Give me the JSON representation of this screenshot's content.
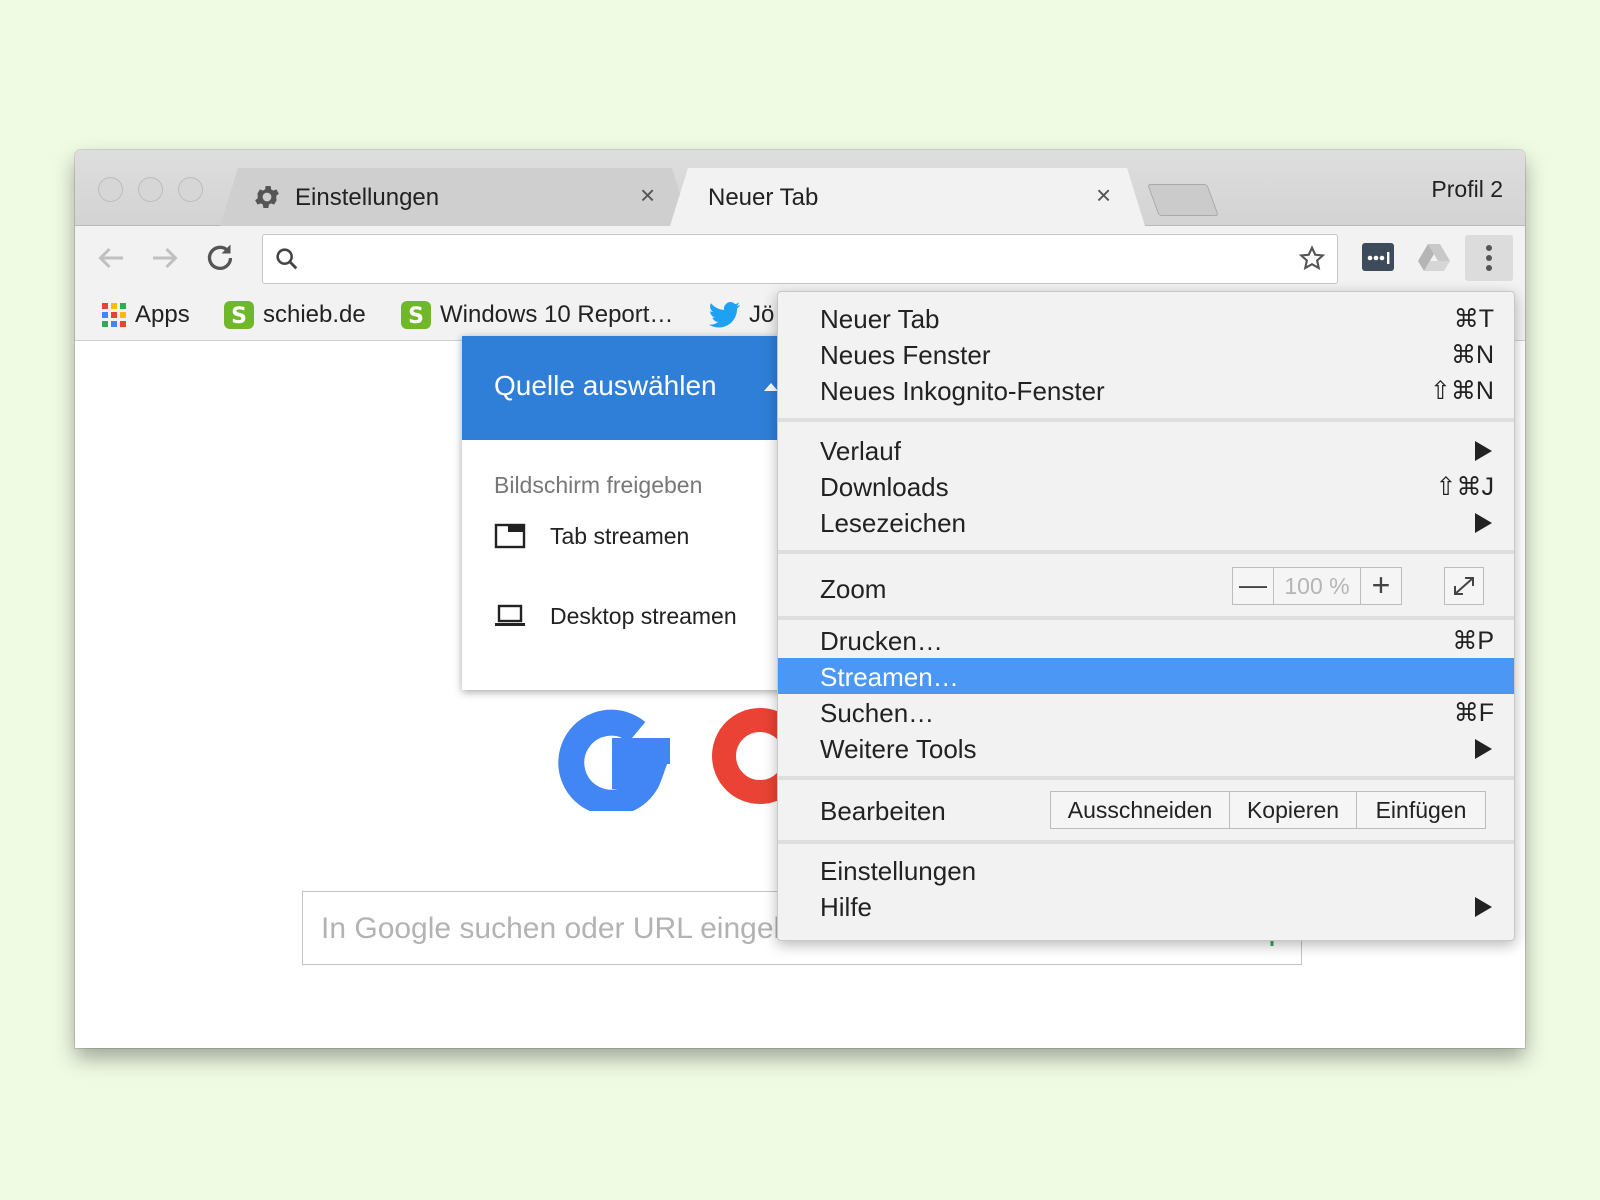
{
  "window": {
    "tabs": [
      {
        "label": "Einstellungen",
        "icon": "gear-icon",
        "active": false
      },
      {
        "label": "Neuer Tab",
        "active": true
      }
    ],
    "close_glyph": "×",
    "profile": "Profil 2"
  },
  "bookmarks": [
    {
      "label": "Apps",
      "icon": "apps-grid-icon"
    },
    {
      "label": "schieb.de",
      "icon": "schieb-icon"
    },
    {
      "label": "Windows 10 Report…",
      "icon": "schieb-icon"
    },
    {
      "label": "Jö",
      "icon": "twitter-icon"
    }
  ],
  "newtab": {
    "search_placeholder": "In Google suchen oder URL eingeben"
  },
  "cast_popup": {
    "title": "Quelle auswählen",
    "section": "Bildschirm freigeben",
    "items": [
      {
        "label": "Tab streamen",
        "icon": "tab-icon"
      },
      {
        "label": "Desktop streamen",
        "icon": "laptop-icon"
      }
    ]
  },
  "menu": {
    "group1": [
      {
        "label": "Neuer Tab",
        "shortcut": "⌘T"
      },
      {
        "label": "Neues Fenster",
        "shortcut": "⌘N"
      },
      {
        "label": "Neues Inkognito-Fenster",
        "shortcut": "⇧⌘N"
      }
    ],
    "group2": [
      {
        "label": "Verlauf",
        "shortcut": ""
      },
      {
        "label": "Downloads",
        "shortcut": "⇧⌘J"
      },
      {
        "label": "Lesezeichen",
        "shortcut": ""
      }
    ],
    "zoom": {
      "label": "Zoom",
      "minus": "—",
      "value": "100 %",
      "plus": "+"
    },
    "group3": [
      {
        "label": "Drucken…",
        "shortcut": "⌘P"
      },
      {
        "label": "Streamen…",
        "shortcut": "",
        "highlighted": true
      },
      {
        "label": "Suchen…",
        "shortcut": "⌘F"
      },
      {
        "label": "Weitere Tools",
        "shortcut": ""
      }
    ],
    "edit": {
      "label": "Bearbeiten",
      "cut": "Ausschneiden",
      "copy": "Kopieren",
      "paste": "Einfügen"
    },
    "group4": [
      {
        "label": "Einstellungen",
        "shortcut": ""
      },
      {
        "label": "Hilfe",
        "shortcut": ""
      }
    ]
  },
  "colors": {
    "accent_blue": "#2f7fd8",
    "menu_highlight": "#4a97f5",
    "google_blue": "#4285f4",
    "google_red": "#ea4335",
    "google_yellow": "#fbbc05"
  }
}
